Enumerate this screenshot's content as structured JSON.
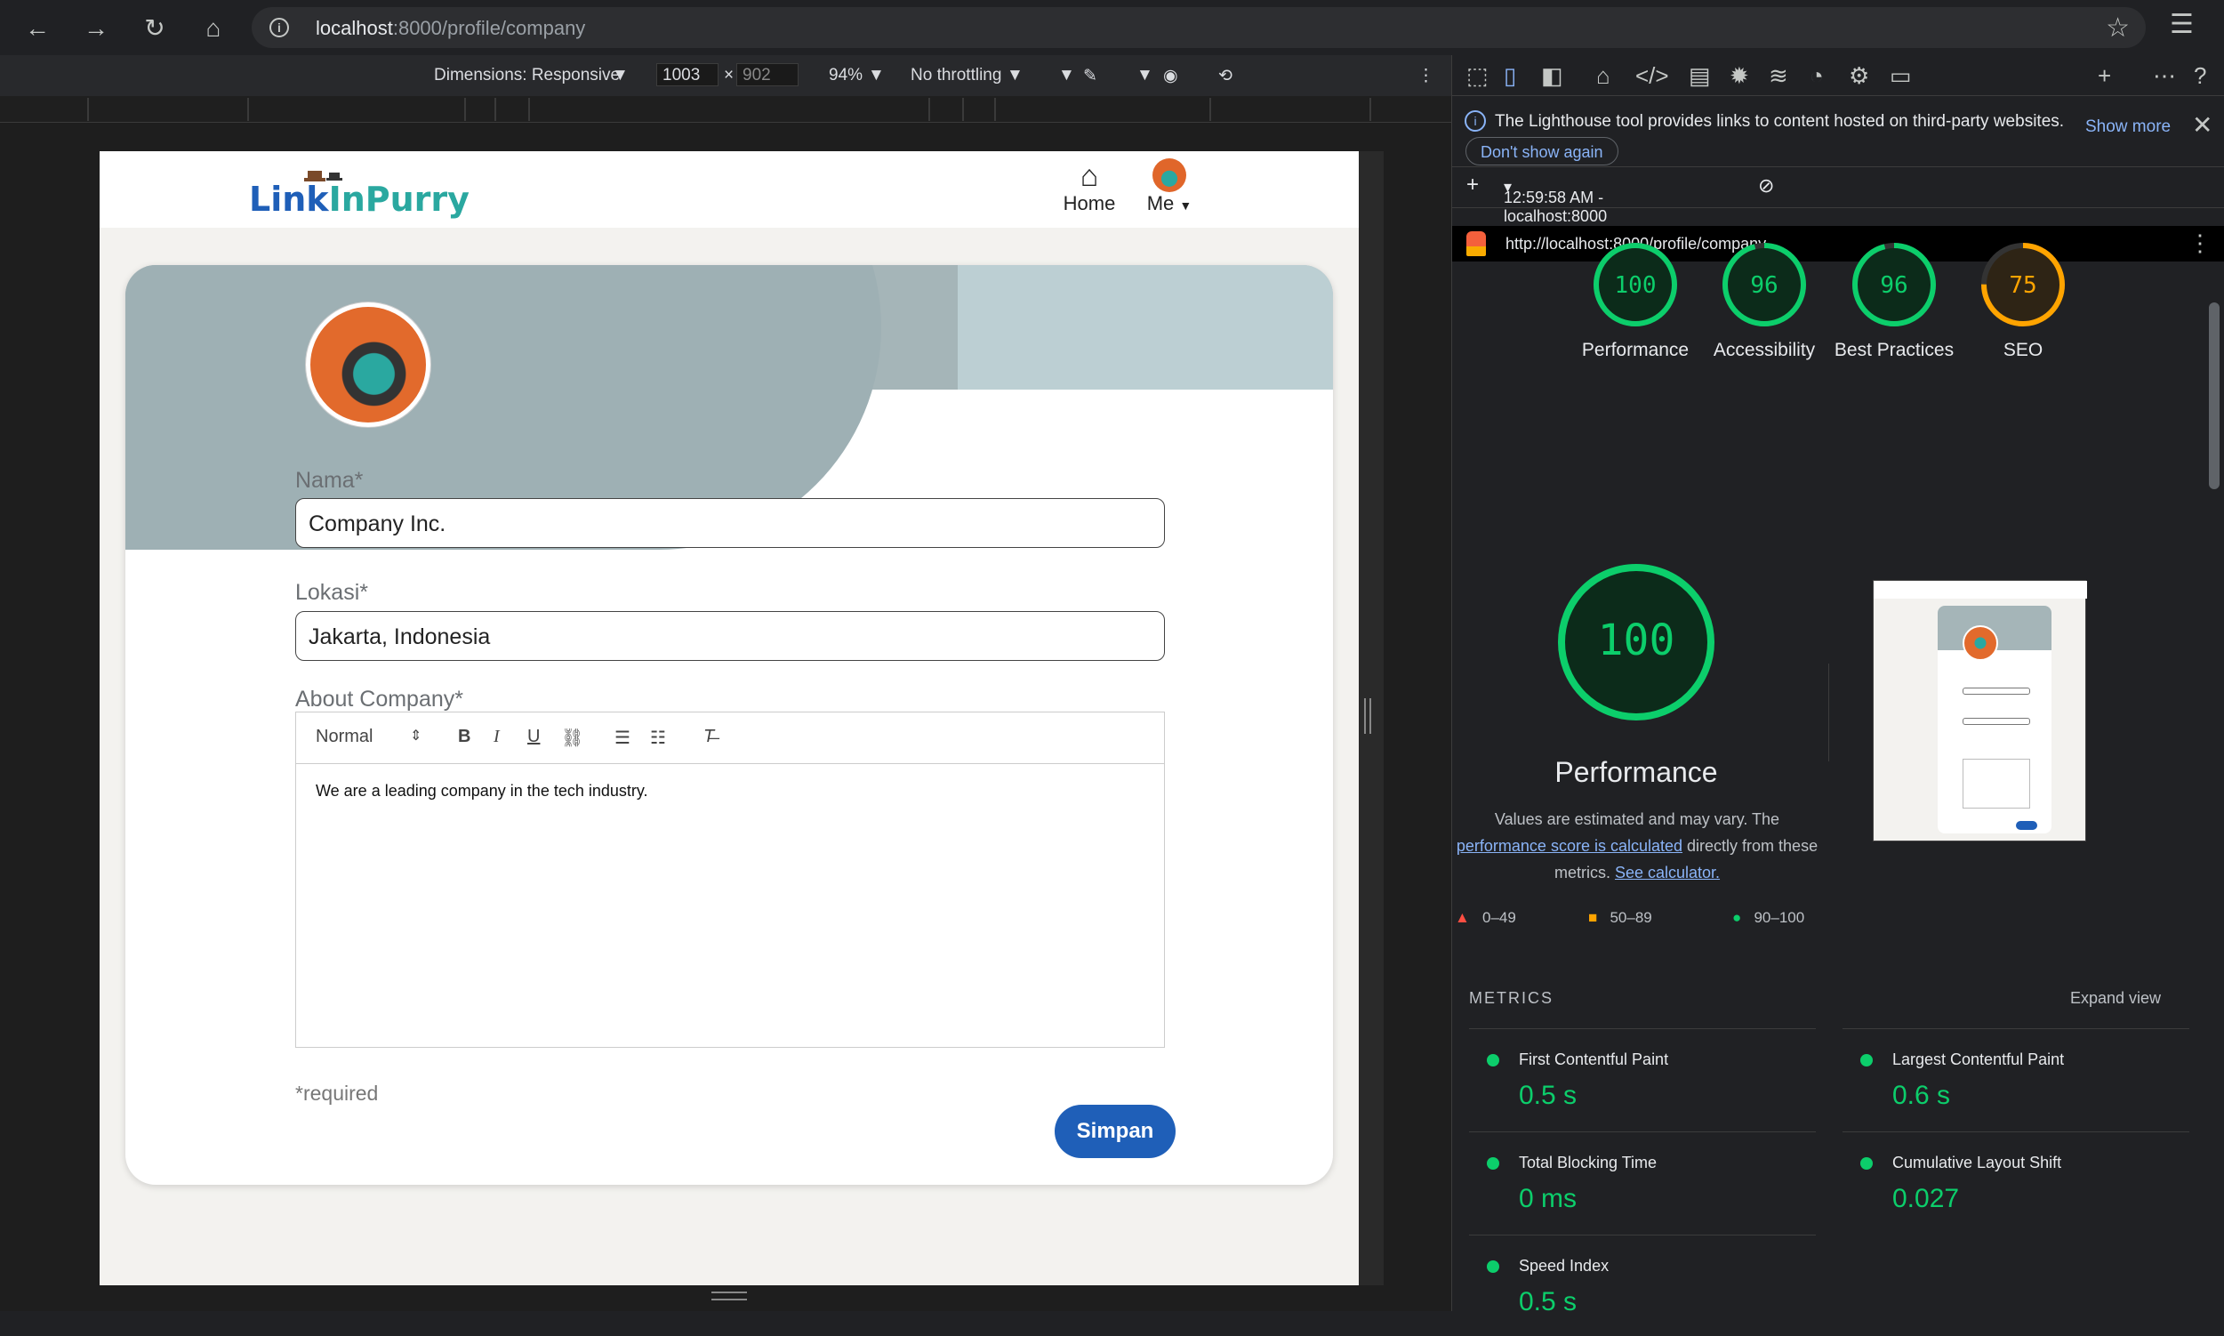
{
  "browser": {
    "url_host": "localhost",
    "url_path": ":8000/profile/company"
  },
  "device_toolbar": {
    "dimensions": "Dimensions: Responsive",
    "width": "1003",
    "height": "902",
    "zoom": "94%",
    "throttling": "No throttling"
  },
  "site": {
    "logo_part1": "Link",
    "logo_part2": "InPurry",
    "nav_home": "Home",
    "nav_me": "Me"
  },
  "form": {
    "name_label": "Nama*",
    "name_value": "Company Inc.",
    "location_label": "Lokasi*",
    "location_value": "Jakarta, Indonesia",
    "about_label": "About Company*",
    "editor_format": "Normal",
    "about_text": "We are a leading company in the tech industry.",
    "required_note": "*required",
    "save_label": "Simpan"
  },
  "devtools": {
    "info_message": "The Lighthouse tool provides links to content hosted on third-party websites.",
    "dont_show": "Don't show again",
    "show_more": "Show more",
    "run_label": "12:59:58 AM - localhost:8000",
    "report_url": "http://localhost:8000/profile/company",
    "scores": [
      {
        "label": "Performance",
        "value": 100,
        "color": "#0cce6b"
      },
      {
        "label": "Accessibility",
        "value": 96,
        "color": "#0cce6b"
      },
      {
        "label": "Best Practices",
        "value": 96,
        "color": "#0cce6b"
      },
      {
        "label": "SEO",
        "value": 75,
        "color": "#ffa400"
      }
    ],
    "big_score": 100,
    "big_title": "Performance",
    "desc_part1": "Values are estimated and may vary. The",
    "desc_link1": "performance score is calculated",
    "desc_part2": "directly from these metrics.",
    "desc_link2": "See calculator.",
    "legend": [
      "0–49",
      "50–89",
      "90–100"
    ],
    "metrics_heading": "METRICS",
    "expand_view": "Expand view",
    "metrics": [
      {
        "name": "First Contentful Paint",
        "value": "0.5 s"
      },
      {
        "name": "Largest Contentful Paint",
        "value": "0.6 s"
      },
      {
        "name": "Total Blocking Time",
        "value": "0 ms"
      },
      {
        "name": "Cumulative Layout Shift",
        "value": "0.027"
      },
      {
        "name": "Speed Index",
        "value": "0.5 s"
      }
    ]
  }
}
